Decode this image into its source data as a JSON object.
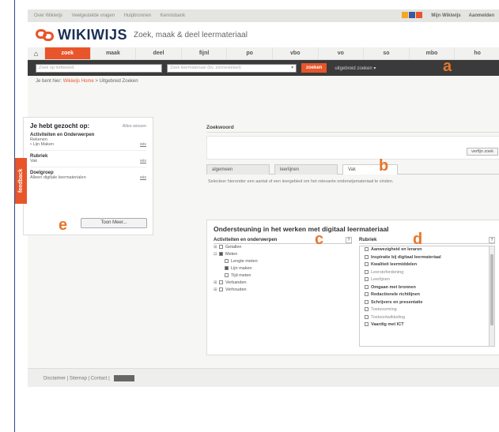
{
  "topbar": {
    "links": [
      "Over Wikiwijs",
      "Veelgestelde vragen",
      "Hulpbronnen",
      "Kennisbank"
    ],
    "my_wikiwijs": "Mijn Wikiwijs",
    "login": "Aanmelden"
  },
  "brand": {
    "logo": "WIKIWIJS",
    "tagline": "Zoek, maak & deel leermateriaal"
  },
  "navtabs": [
    "zoek",
    "maak",
    "deel",
    "fijnl",
    "po",
    "vbo",
    "vo",
    "so",
    "mbo",
    "ho"
  ],
  "search": {
    "placeholder": "Zoek op trefwoord",
    "select_value": "Zoek leermateriaal (bv. zonnestelsel)",
    "button": "zoeken",
    "advanced": "uitgebreid zoeken ▾"
  },
  "markers": {
    "a": "a",
    "b": "b",
    "c": "c",
    "d": "d",
    "e": "e"
  },
  "breadcrumb": {
    "prefix": "Je bent hier:",
    "link": "Wikiwijs Home",
    "current": "> Uitgebreid Zoeken"
  },
  "sidebar": {
    "title": "Je hebt gezocht op:",
    "clear": "Alles wissen",
    "sections": [
      {
        "title": "Activiteiten en Onderwerpen",
        "values": [
          "Rekenen",
          "• Lijn Maken"
        ]
      },
      {
        "title": "Rubriek",
        "values": [
          "Vak"
        ]
      },
      {
        "title": "Doelgroep",
        "values": [
          "Alleen digitale leermaterialen"
        ]
      }
    ],
    "remove": "wis",
    "more_button": "Toon Meer..."
  },
  "feedback": "feedback",
  "main": {
    "title": "Zoekwoord",
    "zoek_button": "verfijn zoek",
    "tabs": [
      "algemeen",
      "leerlijnen",
      "Vak"
    ],
    "description": "Selecteer hieronder een aantal of een leergebied om het relevante onderwijsmateriaal te vinden."
  },
  "lower": {
    "title": "Ondersteuning in het werken met digitaal leermateriaal",
    "col1_header": "Activiteiten en onderwerpen",
    "col1_q": "?",
    "tree": [
      {
        "exp": "⊞",
        "checked": false,
        "label": "Getallen",
        "indent": 0
      },
      {
        "exp": "⊟",
        "checked": true,
        "label": "Meten",
        "indent": 0
      },
      {
        "exp": "",
        "checked": false,
        "label": "Lengte meten",
        "indent": 1
      },
      {
        "exp": "",
        "checked": true,
        "label": "Lijn maken",
        "indent": 1
      },
      {
        "exp": "",
        "checked": false,
        "label": "Tijd meten",
        "indent": 1
      },
      {
        "exp": "⊞",
        "checked": false,
        "label": "Verbanden",
        "indent": 0
      },
      {
        "exp": "⊞",
        "checked": false,
        "label": "Verhouden",
        "indent": 0
      }
    ],
    "col2_header": "Rubriek",
    "col2_q": "?",
    "list": [
      {
        "label": "Aanwezigheid en leraren",
        "bold": true
      },
      {
        "label": "Inspiratie bij digitaal leermateriaal",
        "bold": true
      },
      {
        "label": "Kwaliteit leermiddelen",
        "bold": true
      },
      {
        "label": "Leerstofordening",
        "bold": false
      },
      {
        "label": "Leerlijnen",
        "bold": false
      },
      {
        "label": "Omgaan met bronnen",
        "bold": true
      },
      {
        "label": "Redactionele richtlijnen",
        "bold": true
      },
      {
        "label": "Schrijvers en presentatie",
        "bold": true
      },
      {
        "label": "Toetsvorming",
        "bold": false
      },
      {
        "label": "Toetsontwikkeling",
        "bold": false
      },
      {
        "label": "Vaardig met ICT",
        "bold": true
      }
    ]
  },
  "footer": {
    "links": "Disclaimer | Sitemap | Contact |"
  }
}
